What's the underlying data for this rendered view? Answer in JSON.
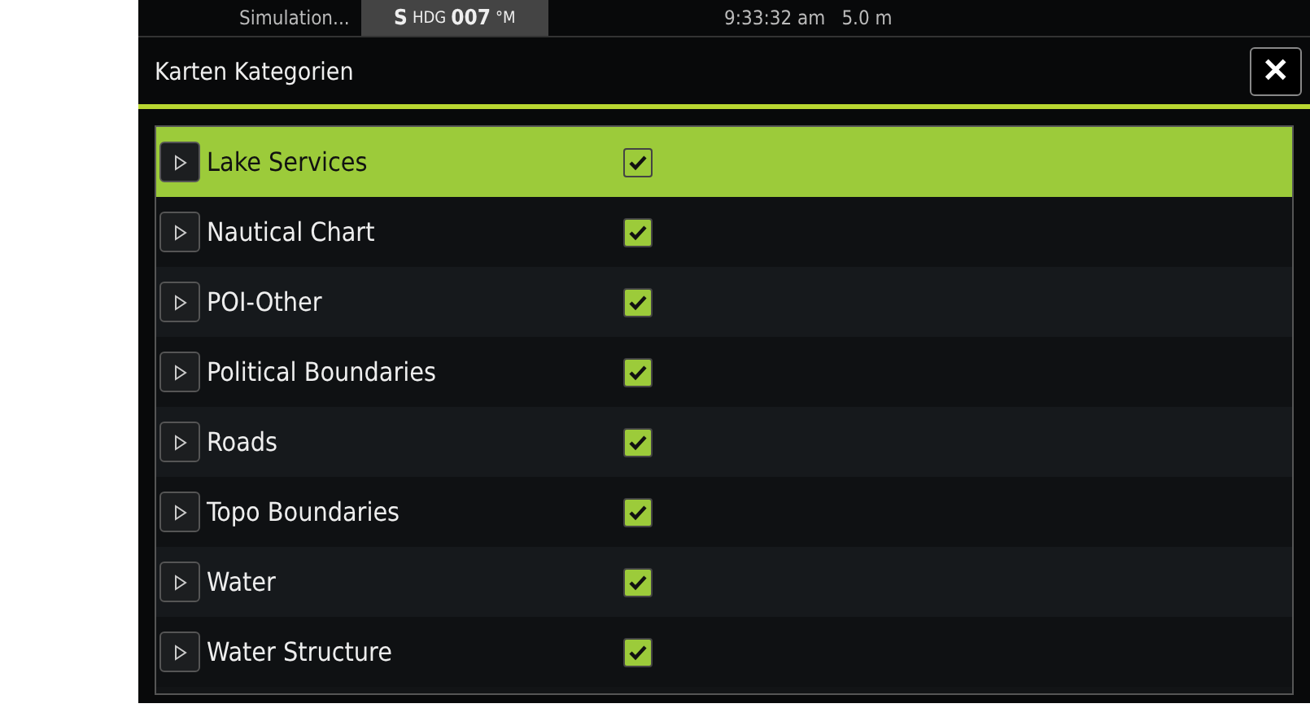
{
  "status_bar": {
    "mode": "Simulation...",
    "heading": {
      "prefix": "S",
      "label": "HDG",
      "value": "007",
      "unit": "°M"
    },
    "time": "9:33:32 am",
    "depth": "5.0 m"
  },
  "dialog": {
    "title": "Karten Kategorien",
    "close": "✕"
  },
  "categories": [
    {
      "label": "Lake Services",
      "selected": true,
      "checked": true
    },
    {
      "label": "Nautical Chart",
      "selected": false,
      "checked": true
    },
    {
      "label": "POI-Other",
      "selected": false,
      "checked": true
    },
    {
      "label": "Political Boundaries",
      "selected": false,
      "checked": true
    },
    {
      "label": "Roads",
      "selected": false,
      "checked": true
    },
    {
      "label": "Topo Boundaries",
      "selected": false,
      "checked": true
    },
    {
      "label": "Water",
      "selected": false,
      "checked": true
    },
    {
      "label": "Water Structure",
      "selected": false,
      "checked": true
    }
  ]
}
